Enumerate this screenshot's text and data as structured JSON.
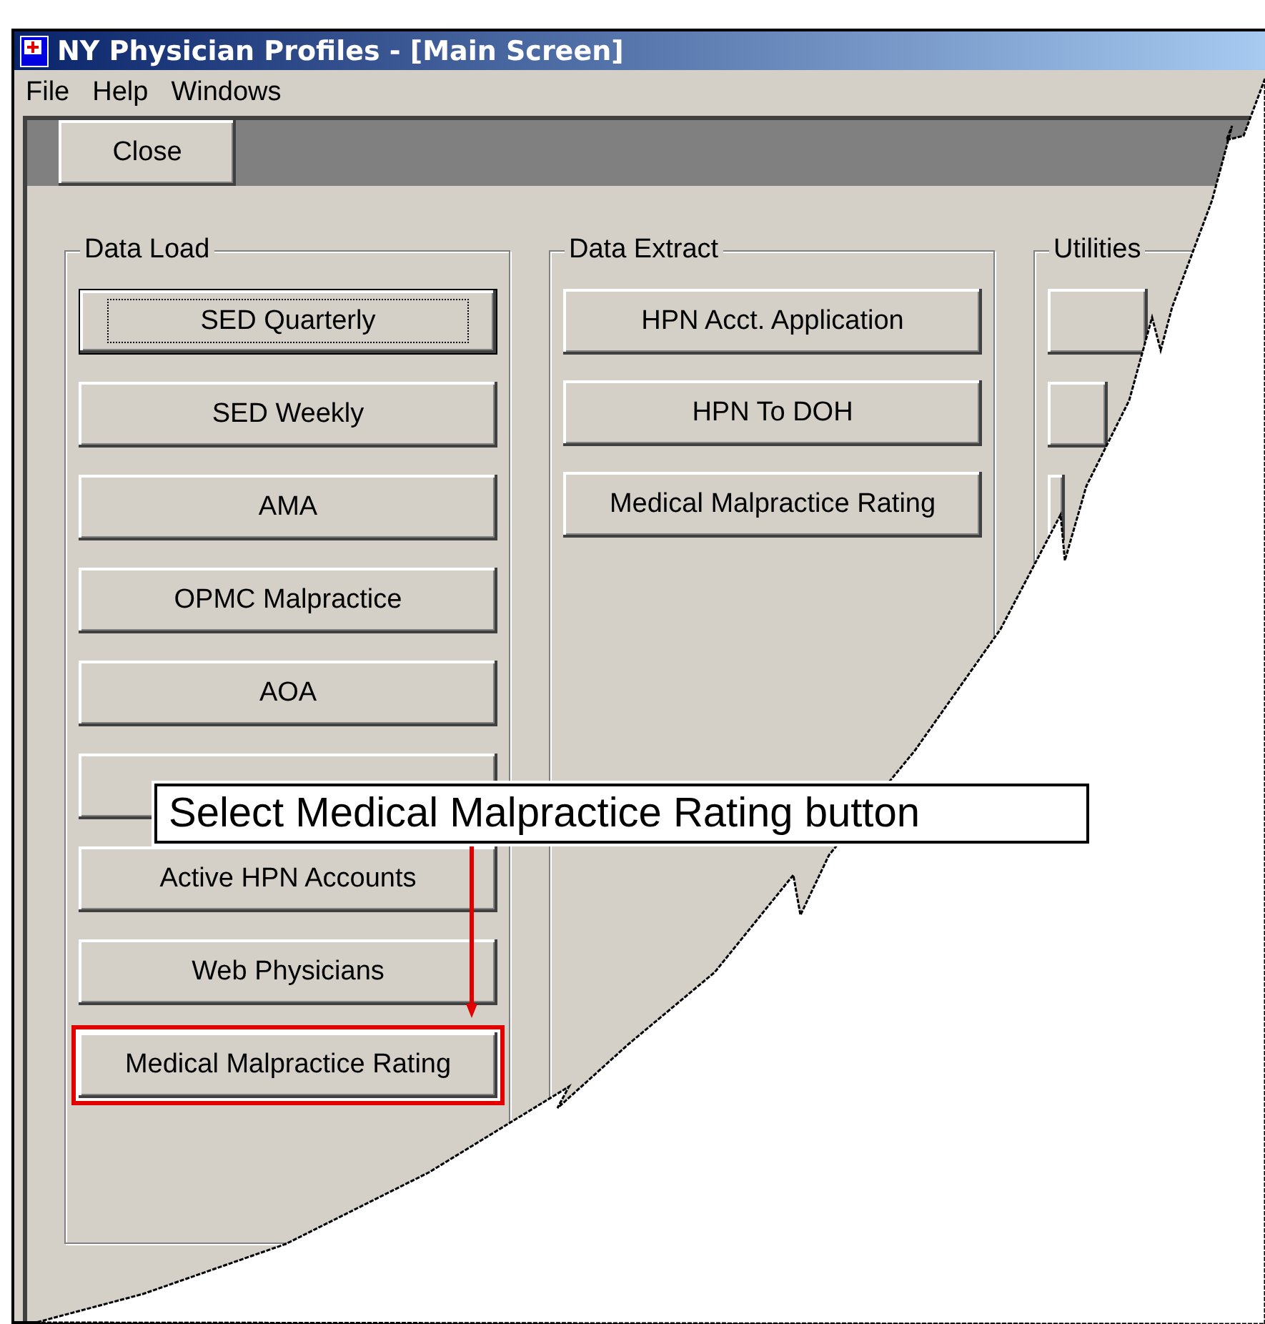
{
  "window": {
    "title": "NY Physician Profiles - [Main Screen]"
  },
  "menu": [
    "File",
    "Help",
    "Windows"
  ],
  "toolbar": {
    "buttons": [
      "Close"
    ]
  },
  "groups": [
    {
      "title": "Data Load",
      "buttons": [
        {
          "label": "SED Quarterly",
          "focused": true,
          "highlighted": false
        },
        {
          "label": "SED Weekly",
          "focused": false,
          "highlighted": false
        },
        {
          "label": "AMA",
          "focused": false,
          "highlighted": false
        },
        {
          "label": "OPMC Malpractice",
          "focused": false,
          "highlighted": false
        },
        {
          "label": "AOA",
          "focused": false,
          "highlighted": false
        },
        {
          "focused": false,
          "highlighted": false
        },
        {
          "label": "Active HPN Accounts",
          "focused": false,
          "highlighted": false
        },
        {
          "label": "Web Physicians",
          "focused": false,
          "highlighted": false
        },
        {
          "label": "Medical Malpractice Rating",
          "focused": false,
          "highlighted": true
        }
      ]
    },
    {
      "title": "Data Extract",
      "buttons": [
        {
          "label": "HPN Acct. Application",
          "focused": false,
          "highlighted": false
        },
        {
          "label": "HPN To DOH",
          "focused": false,
          "highlighted": false
        },
        {
          "label": "Medical Malpractice Rating",
          "focused": false,
          "highlighted": false
        }
      ]
    },
    {
      "title": "Utilities",
      "buttons": [
        {
          "focused": false,
          "highlighted": false
        },
        {
          "focused": false,
          "highlighted": false
        },
        {
          "focused": false,
          "highlighted": false
        }
      ]
    }
  ],
  "callout": {
    "text": "Select Medical Malpractice Rating button"
  }
}
